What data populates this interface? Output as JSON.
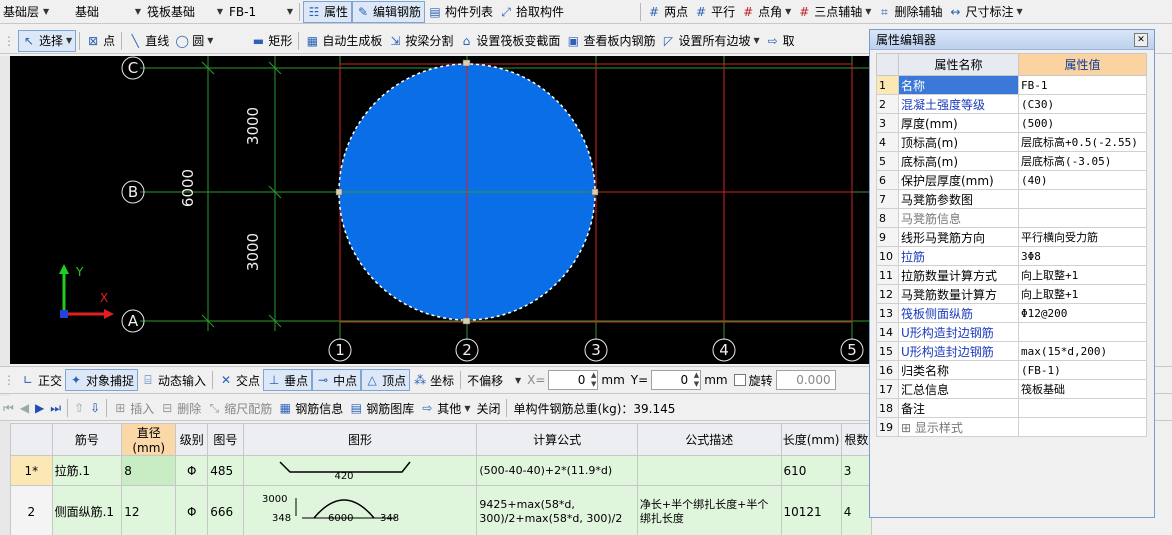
{
  "toolbar1": {
    "floor": "基础层",
    "category": "基础",
    "type": "筏板基础",
    "element": "FB-1",
    "attr": "属性",
    "edit_rebar": "编辑钢筋",
    "member_list": "构件列表",
    "pick_member": "拾取构件",
    "two_point": "两点",
    "parallel": "平行",
    "point_angle": "点角",
    "three_point_aux": "三点辅轴",
    "delete_aux": "删除辅轴",
    "dim": "尺寸标注"
  },
  "toolbar2": {
    "select": "选择",
    "point": "点",
    "line": "直线",
    "circle": "圆",
    "rect": "矩形",
    "auto_gen": "自动生成板",
    "split_beam": "按梁分割",
    "set_section": "设置筏板变截面",
    "view_rebar": "查看板内钢筋",
    "set_slope": "设置所有边坡",
    "more": "取"
  },
  "drawing": {
    "axis_rows": [
      "C",
      "B",
      "A"
    ],
    "axis_cols": [
      "1",
      "2",
      "3",
      "4",
      "5"
    ],
    "dim_top": "3000",
    "dim_bottom": "3000",
    "dim_total": "6000",
    "axis_y": "Y",
    "axis_x": "X",
    "circle_color": "#0a6fe6"
  },
  "toolbar3": {
    "ortho": "正交",
    "snap": "对象捕捉",
    "dyn_input": "动态输入",
    "intersect": "交点",
    "perp": "垂点",
    "mid": "中点",
    "vertex": "顶点",
    "coord": "坐标",
    "no_offset": "不偏移",
    "x_label": "X=",
    "x_value": "0",
    "mm1": "mm",
    "y_label": "Y=",
    "y_value": "0",
    "mm2": "mm",
    "rotate": "旋转",
    "rotate_value": "0.000"
  },
  "toolbar4": {
    "insert": "插入",
    "delete": "删除",
    "scale": "缩尺配筋",
    "rebar_info": "钢筋信息",
    "rebar_lib": "钢筋图库",
    "other": "其他",
    "close": "关闭",
    "total_weight": "单构件钢筋总重(kg)：39.145"
  },
  "grid": {
    "headers": [
      "筋号",
      "直径(mm)",
      "级别",
      "图号",
      "图形",
      "计算公式",
      "公式描述",
      "长度(mm)",
      "根数"
    ],
    "rows": [
      {
        "no": "1*",
        "name": "拉筋.1",
        "dia": "8",
        "grade": "Φ",
        "fig": "485",
        "shape_value": "420",
        "formula": "(500-40-40)+2*(11.9*d)",
        "desc": "",
        "len": "610",
        "count": "3"
      },
      {
        "no": "2",
        "name": "侧面纵筋.1",
        "dia": "12",
        "grade": "Φ",
        "fig": "666",
        "shape_h": "3000",
        "shape_l": "348",
        "shape_m": "6000",
        "shape_r": "348",
        "formula": "9425+max(58*d, 300)/2+max(58*d, 300)/2",
        "desc": "净长+半个绑扎长度+半个绑扎长度",
        "len": "10121",
        "count": "4"
      },
      {
        "no": "3",
        "name": "",
        "dia": "",
        "grade": "",
        "fig": "",
        "formula": "",
        "desc": "",
        "len": "",
        "count": ""
      }
    ]
  },
  "props": {
    "title": "属性编辑器",
    "col_name": "属性名称",
    "col_value": "属性值",
    "rows": [
      {
        "n": "1",
        "name": "名称",
        "value": "FB-1",
        "style": "blue"
      },
      {
        "n": "2",
        "name": "混凝土强度等级",
        "value": "(C30)",
        "style": "blue"
      },
      {
        "n": "3",
        "name": "厚度(mm)",
        "value": "(500)",
        "style": ""
      },
      {
        "n": "4",
        "name": "顶标高(m)",
        "value": "层底标高+0.5(-2.55)",
        "style": ""
      },
      {
        "n": "5",
        "name": "底标高(m)",
        "value": "层底标高(-3.05)",
        "style": ""
      },
      {
        "n": "6",
        "name": "保护层厚度(mm)",
        "value": "(40)",
        "style": ""
      },
      {
        "n": "7",
        "name": "马凳筋参数图",
        "value": "",
        "style": ""
      },
      {
        "n": "8",
        "name": "马凳筋信息",
        "value": "",
        "style": "dim"
      },
      {
        "n": "9",
        "name": "线形马凳筋方向",
        "value": "平行横向受力筋",
        "style": ""
      },
      {
        "n": "10",
        "name": "拉筋",
        "value": "3Φ8",
        "style": "blue"
      },
      {
        "n": "11",
        "name": "拉筋数量计算方式",
        "value": "向上取整+1",
        "style": ""
      },
      {
        "n": "12",
        "name": "马凳筋数量计算方",
        "value": "向上取整+1",
        "style": ""
      },
      {
        "n": "13",
        "name": "筏板侧面纵筋",
        "value": "Φ12@200",
        "style": "blue"
      },
      {
        "n": "14",
        "name": "U形构造封边钢筋",
        "value": "",
        "style": "blue"
      },
      {
        "n": "15",
        "name": "U形构造封边钢筋",
        "value": "max(15*d,200)",
        "style": "blue"
      },
      {
        "n": "16",
        "name": "归类名称",
        "value": "(FB-1)",
        "style": ""
      },
      {
        "n": "17",
        "name": "汇总信息",
        "value": "筏板基础",
        "style": ""
      },
      {
        "n": "18",
        "name": "备注",
        "value": "",
        "style": ""
      },
      {
        "n": "19",
        "name": "显示样式",
        "value": "",
        "style": "dim"
      }
    ]
  }
}
